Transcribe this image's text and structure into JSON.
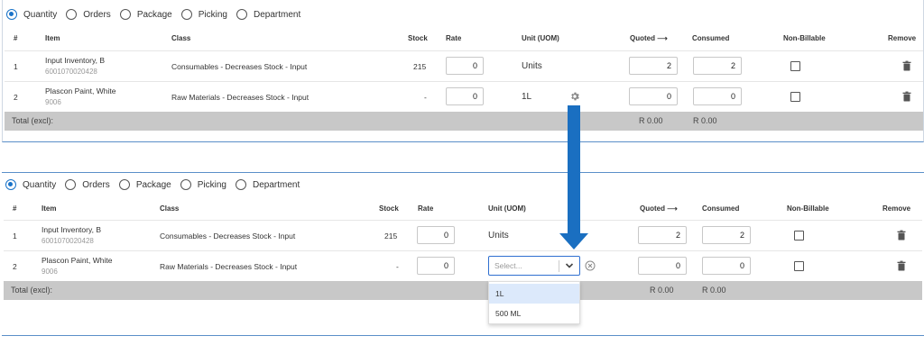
{
  "radio_options": [
    {
      "label": "Quantity",
      "selected": true
    },
    {
      "label": "Orders",
      "selected": false
    },
    {
      "label": "Package",
      "selected": false
    },
    {
      "label": "Picking",
      "selected": false
    },
    {
      "label": "Department",
      "selected": false
    }
  ],
  "columns": {
    "num": "#",
    "item": "Item",
    "class": "Class",
    "stock": "Stock",
    "rate": "Rate",
    "unit": "Unit (UOM)",
    "quoted": "Quoted ⟶",
    "consumed": "Consumed",
    "nonbillable": "Non-Billable",
    "remove": "Remove"
  },
  "rows": [
    {
      "num": "1",
      "item": "Input Inventory, B",
      "code": "6001070020428",
      "class": "Consumables - Decreases Stock - Input",
      "stock": "215",
      "rate": "0",
      "unit": "Units",
      "quoted": "2",
      "consumed": "2"
    },
    {
      "num": "2",
      "item": "Plascon Paint, White",
      "code": "9006",
      "class": "Raw Materials - Decreases Stock - Input",
      "stock": "-",
      "rate": "0",
      "unit": "1L",
      "quoted": "0",
      "consumed": "0"
    }
  ],
  "total": {
    "label": "Total (excl):",
    "quoted": "R 0.00",
    "consumed": "R 0.00"
  },
  "unit_select": {
    "placeholder": "Select...",
    "options": [
      "1L",
      "500 ML"
    ]
  },
  "colors": {
    "accent": "#1a73c8",
    "arrow": "#1a6fc1",
    "total_bar": "#c8c8c8"
  }
}
